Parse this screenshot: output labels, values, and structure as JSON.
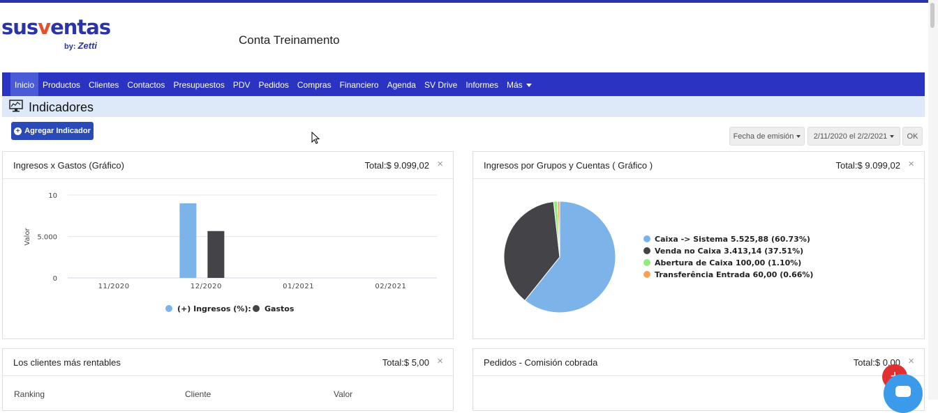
{
  "brand": {
    "part1": "sus",
    "part2": "v",
    "part3": "entas",
    "by": "by:",
    "by_brand": "Zetti"
  },
  "account": "Conta Treinamento",
  "nav": [
    {
      "label": "Inicio",
      "active": true
    },
    {
      "label": "Productos"
    },
    {
      "label": "Clientes"
    },
    {
      "label": "Contactos"
    },
    {
      "label": "Presupuestos"
    },
    {
      "label": "PDV"
    },
    {
      "label": "Pedidos"
    },
    {
      "label": "Compras"
    },
    {
      "label": "Financiero"
    },
    {
      "label": "Agenda"
    },
    {
      "label": "SV Drive"
    },
    {
      "label": "Informes"
    },
    {
      "label": "Más"
    }
  ],
  "page_title": "Indicadores",
  "add_button": "Agregar Indicador",
  "filters": {
    "date_type": "Fecha de emisión",
    "date_range": "2/11/2020 el 2/2/2021",
    "ok": "OK"
  },
  "panels": {
    "p1": {
      "title": "Ingresos x Gastos (Gráfico)",
      "total": "Total:$ 9.099,02"
    },
    "p2": {
      "title": "Ingresos por Grupos y Cuentas ( Gráfico )",
      "total": "Total:$ 9.099,02"
    },
    "p3": {
      "title": "Los clientes más rentables",
      "total": "Total:$ 5,00",
      "columns": [
        "Ranking",
        "Cliente",
        "Valor"
      ]
    },
    "p4": {
      "title": "Pedidos - Comisión cobrada",
      "total": "Total:$ 0,00"
    }
  },
  "close_glyph": "×",
  "chart_data": [
    {
      "type": "bar",
      "categories": [
        "11/2020",
        "12/2020",
        "01/2021",
        "02/2021"
      ],
      "ylabel": "Valor",
      "yticks": [
        "0",
        "5.000",
        "10"
      ],
      "ylim": [
        0,
        10000
      ],
      "series": [
        {
          "name": "(+) Ingresos (%):",
          "color": "#7cb4ea",
          "values": [
            0,
            9000,
            0,
            0
          ]
        },
        {
          "name": "Gastos",
          "color": "#434348",
          "values": [
            0,
            5650,
            0,
            0
          ]
        }
      ],
      "legend": "bottom"
    },
    {
      "type": "pie",
      "slices": [
        {
          "label": "Caixa -> Sistema 5.525,88 (60.73%)",
          "value": 60.73,
          "color": "#7cb4ea"
        },
        {
          "label": "Venda no Caixa 3.413,14 (37.51%)",
          "value": 37.51,
          "color": "#434348"
        },
        {
          "label": "Abertura de Caixa 100,00 (1.10%)",
          "value": 1.1,
          "color": "#90ed7d"
        },
        {
          "label": "Transferência Entrada 60,00 (0.66%)",
          "value": 0.66,
          "color": "#f7a35c"
        }
      ],
      "legend": "right"
    }
  ]
}
